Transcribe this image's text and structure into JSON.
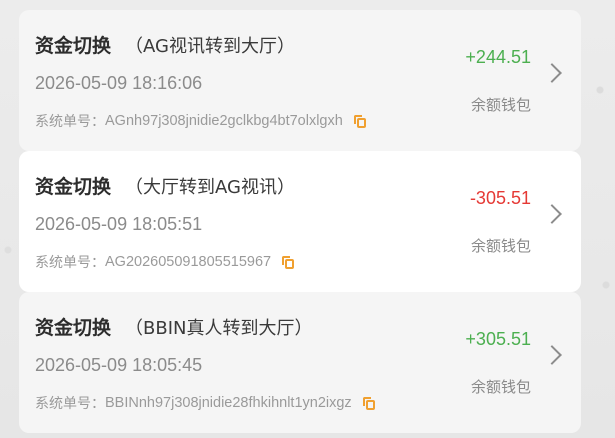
{
  "records": [
    {
      "title": "资金切换",
      "subtitle": "（AG视讯转到大厅）",
      "time": "2026-05-09 18:16:06",
      "order_label": "系统单号：",
      "order_no": "AGnh97j308jnidie2gclkbg4bt7olxlgxh",
      "amount": "+244.51",
      "amount_color": "#4caf50",
      "wallet": "余额钱包"
    },
    {
      "title": "资金切换",
      "subtitle": "（大厅转到AG视讯）",
      "time": "2026-05-09 18:05:51",
      "order_label": "系统单号：",
      "order_no": "AG202605091805515967",
      "amount": "-305.51",
      "amount_color": "#e53935",
      "wallet": "余额钱包"
    },
    {
      "title": "资金切换",
      "subtitle": "（BBIN真人转到大厅）",
      "time": "2026-05-09 18:05:45",
      "order_label": "系统单号：",
      "order_no": "BBINnh97j308jnidie28fhkihnlt1yn2ixgz",
      "amount": "+305.51",
      "amount_color": "#4caf50",
      "wallet": "余额钱包"
    }
  ],
  "icons": {
    "copy": "copy-icon",
    "chevron": "chevron-right-icon"
  }
}
